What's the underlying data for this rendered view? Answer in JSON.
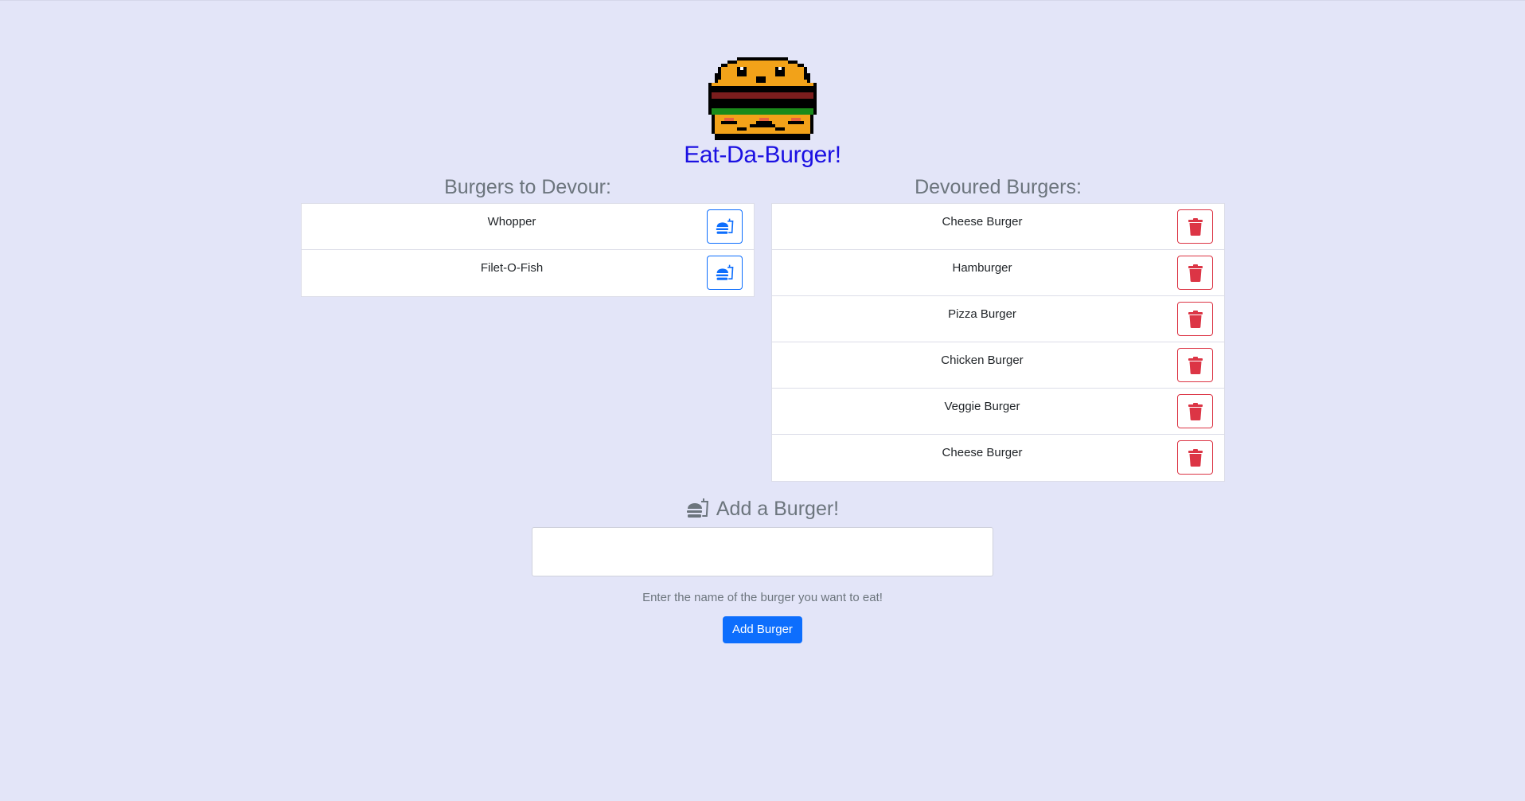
{
  "header": {
    "title": "Eat-Da-Burger!",
    "logo_icon": "pixel-burger-logo"
  },
  "to_devour": {
    "title": "Burgers to Devour:",
    "action_icon": "hamburger-soda-icon",
    "items": [
      {
        "name": "Whopper"
      },
      {
        "name": "Filet-O-Fish"
      }
    ]
  },
  "devoured": {
    "title": "Devoured Burgers:",
    "action_icon": "trash-icon",
    "items": [
      {
        "name": "Cheese Burger"
      },
      {
        "name": "Hamburger"
      },
      {
        "name": "Pizza Burger"
      },
      {
        "name": "Chicken Burger"
      },
      {
        "name": "Veggie Burger"
      },
      {
        "name": "Cheese Burger"
      }
    ]
  },
  "add": {
    "title": "Add a Burger!",
    "icon": "hamburger-soda-icon",
    "input_value": "",
    "help": "Enter the name of the burger you want to eat!",
    "button_label": "Add Burger"
  },
  "colors": {
    "background": "#e3e5f8",
    "title": "#1b10e2",
    "primary": "#0d6efd",
    "danger": "#dc3545",
    "muted": "#6c757d"
  }
}
